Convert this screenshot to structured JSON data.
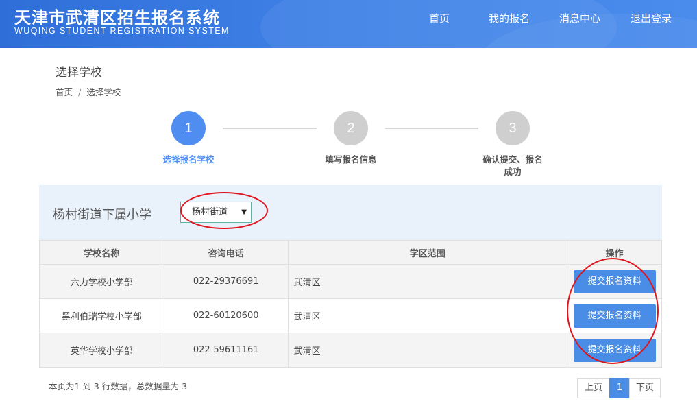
{
  "header": {
    "title_cn": "天津市武清区招生报名系统",
    "title_en": "WUQING STUDENT REGISTRATION SYSTEM",
    "nav": [
      "首页",
      "我的报名",
      "消息中心",
      "退出登录"
    ]
  },
  "page": {
    "title": "选择学校",
    "breadcrumb": [
      "首页",
      "选择学校"
    ]
  },
  "steps": [
    {
      "number": "1",
      "label": "选择报名学校",
      "active": true
    },
    {
      "number": "2",
      "label": "填写报名信息",
      "active": false
    },
    {
      "number": "3",
      "label_line1": "确认提交、报名",
      "label_line2": "成功",
      "active": false
    }
  ],
  "filter": {
    "title": "杨村街道下属小学",
    "selected": "杨村街道"
  },
  "table": {
    "headers": [
      "学校名称",
      "咨询电话",
      "学区范围",
      "操作"
    ],
    "rows": [
      {
        "name": "六力学校小学部",
        "phone": "022-29376691",
        "range": "武清区",
        "action": "提交报名资料"
      },
      {
        "name": "黑利伯瑞学校小学部",
        "phone": "022-60120600",
        "range": "武清区",
        "action": "提交报名资料"
      },
      {
        "name": "英华学校小学部",
        "phone": "022-59611161",
        "range": "武清区",
        "action": "提交报名资料"
      }
    ]
  },
  "footer": {
    "summary": "本页为1 到 3 行数据，总数据量为 3",
    "pager": {
      "prev": "上页",
      "current": "1",
      "next": "下页"
    }
  },
  "colors": {
    "header_bg": "#3e80e6",
    "accent": "#4f8ef0",
    "button": "#4a8de6",
    "annotation_ring": "#e0141e",
    "filter_bg": "#e9f2fa"
  }
}
